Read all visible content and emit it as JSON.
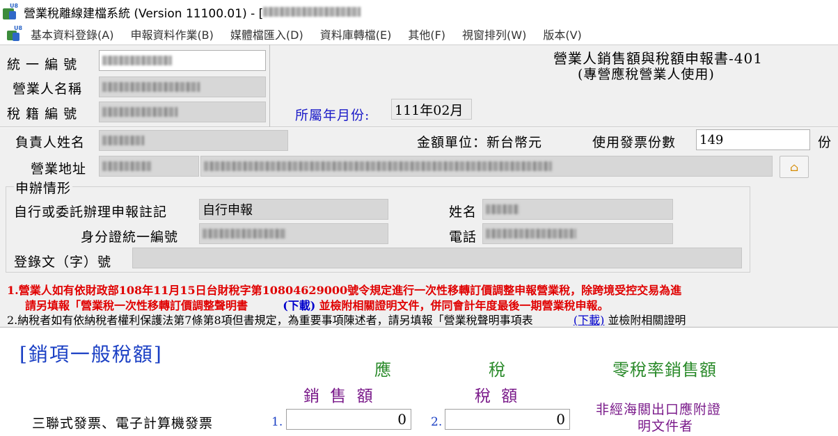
{
  "window": {
    "title": "營業稅離線建檔系統 (Version 11100.01) - ["
  },
  "menu": [
    "基本資料登錄(A)",
    "申報資料作業(B)",
    "媒體檔匯入(D)",
    "資料庫轉檔(E)",
    "其他(F)",
    "視窗排列(W)",
    "版本(V)"
  ],
  "app_badge": "U8",
  "header": {
    "form_title": "營業人銷售額與稅額申報書-401",
    "form_subtitle": "(專營應稅營業人使用)",
    "period_label": "所屬年月份:",
    "period_value": "111年02月"
  },
  "fields": {
    "tax_id_label": "統 一 編 號",
    "business_name_label": "營業人名稱",
    "tax_registration_label": "稅 籍 編 號",
    "owner_label": "負責人姓名",
    "currency_label": "金額單位：新台幣元",
    "invoice_count_label": "使用發票份數",
    "invoice_count_value": "149",
    "invoice_count_unit": "份",
    "address_label": "營業地址"
  },
  "filing": {
    "group_title": "申辦情形",
    "self_or_agent_label": "自行或委託辦理申報註記",
    "self_or_agent_value": "自行申報",
    "id_label": "身分證統一編號",
    "name_label": "姓名",
    "phone_label": "電話",
    "reg_no_label": "登錄文（字）號"
  },
  "notes": {
    "note1_line1": "1.營業人如有依財政部108年11月15日台財稅字第10804629000號令規定進行一次性移轉訂價調整申報營業稅，除跨境受控交易為進",
    "note1_line2_a": "請另填報「營業稅一次性移轉訂價調整聲明書",
    "note1_link": "(下載)",
    "note1_line2_b": "並檢附相關證明文件，併同會計年度最後一期營業稅申報。",
    "note2_a": "2.納稅者如有依納稅者權利保護法第7條第8項但書規定，為重要事項陳述者，請另填報「營業稅聲明事項表",
    "note2_link": "(下載)",
    "note2_b": "並檢附相關證明"
  },
  "sales": {
    "section_title": "[銷項一般稅額]",
    "col_taxable_1": "應",
    "col_taxable_2": "稅",
    "col_zero": "零稅率銷售額",
    "col_sales": "銷 售 額",
    "col_tax": "稅  額",
    "row1_label": "三聯式發票、電子計算機發票",
    "row1_sales_no": "1.",
    "row1_sales_value": "0",
    "row1_tax_no": "2.",
    "row1_tax_value": "0",
    "zero_note_line1": "非經海關出口應附證",
    "zero_note_line2": "明文件者"
  },
  "colors": {
    "red_note": "#e00000",
    "link": "#0000cc",
    "section_title": "#1a3fc4",
    "green": "#2a8a2a",
    "purple": "#7a1a8a",
    "period_label": "#1a1ac8"
  }
}
